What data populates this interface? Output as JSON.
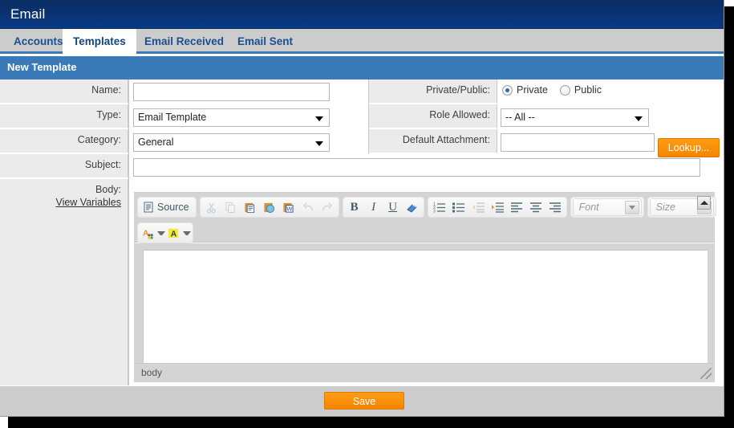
{
  "window": {
    "title": "Email"
  },
  "tabs": [
    {
      "label": "Accounts",
      "active": false
    },
    {
      "label": "Templates",
      "active": true
    },
    {
      "label": "Email Received",
      "active": false
    },
    {
      "label": "Email Sent",
      "active": false
    }
  ],
  "section": {
    "title": "New Template"
  },
  "form": {
    "name": {
      "label": "Name:",
      "value": "",
      "placeholder": ""
    },
    "type": {
      "label": "Type:",
      "value": "Email Template"
    },
    "category": {
      "label": "Category:",
      "value": "General"
    },
    "subject": {
      "label": "Subject:",
      "value": "",
      "placeholder": ""
    },
    "body": {
      "label": "Body:",
      "link": "View Variables"
    },
    "private_public": {
      "label": "Private/Public:",
      "options": [
        {
          "label": "Private",
          "selected": true
        },
        {
          "label": "Public",
          "selected": false
        }
      ]
    },
    "role_allowed": {
      "label": "Role Allowed:",
      "value": "-- All --"
    },
    "default_attachment": {
      "label": "Default Attachment:",
      "value": "",
      "placeholder": "",
      "lookup_label": "Lookup..."
    }
  },
  "editor": {
    "source_label": "Source",
    "path": "body",
    "content": "",
    "font_placeholder": "Font",
    "size_placeholder": "Size",
    "toolbar": {
      "row1": [
        {
          "name": "source-button",
          "label": "Source",
          "disabled": false
        },
        {
          "name": "cut-icon",
          "label": "",
          "disabled": true
        },
        {
          "name": "copy-icon",
          "label": "",
          "disabled": true
        },
        {
          "name": "paste-icon",
          "label": "",
          "disabled": false
        },
        {
          "name": "paste-as-text-icon",
          "label": "",
          "disabled": false
        },
        {
          "name": "paste-from-word-icon",
          "label": "",
          "disabled": false
        },
        {
          "name": "undo-icon",
          "label": "",
          "disabled": true
        },
        {
          "name": "redo-icon",
          "label": "",
          "disabled": true
        },
        {
          "name": "bold-icon",
          "label": "B",
          "disabled": false
        },
        {
          "name": "italic-icon",
          "label": "I",
          "disabled": false
        },
        {
          "name": "underline-icon",
          "label": "U",
          "disabled": false
        },
        {
          "name": "remove-format-icon",
          "label": "",
          "disabled": false
        },
        {
          "name": "numbered-list-icon",
          "label": "",
          "disabled": false
        },
        {
          "name": "bulleted-list-icon",
          "label": "",
          "disabled": false
        },
        {
          "name": "outdent-icon",
          "label": "",
          "disabled": true
        },
        {
          "name": "indent-icon",
          "label": "",
          "disabled": false
        },
        {
          "name": "align-left-icon",
          "label": "",
          "disabled": false
        },
        {
          "name": "align-center-icon",
          "label": "",
          "disabled": false
        },
        {
          "name": "align-right-icon",
          "label": "",
          "disabled": false
        }
      ],
      "row2": [
        {
          "name": "text-color-icon",
          "label": "",
          "disabled": false
        },
        {
          "name": "background-color-icon",
          "label": "",
          "disabled": false
        }
      ]
    }
  },
  "footer": {
    "save_label": "Save"
  },
  "colors": {
    "titlebar": "#0a3271",
    "tabbar": "#cccccc",
    "section": "#3a7ab8",
    "tab_text": "#1b4f8f",
    "label_bg": "#ebebeb",
    "accent_orange": "#f58500",
    "footer_bg": "#cccccc"
  }
}
